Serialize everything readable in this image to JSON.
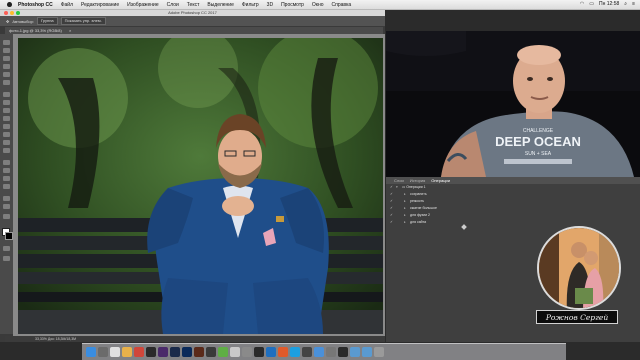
{
  "menubar": {
    "app_name": "Photoshop CC",
    "items": [
      "Файл",
      "Редактирование",
      "Изображение",
      "Слои",
      "Текст",
      "Выделение",
      "Фильтр",
      "3D",
      "Просмотр",
      "Окно",
      "Справка"
    ],
    "clock": "Пн 12:58"
  },
  "window": {
    "title": "Adobe Photoshop CC 2017"
  },
  "options": {
    "auto_select": "Автовыбор:",
    "group": "Группа",
    "transform": "Показать упр. элем."
  },
  "document": {
    "tab_label": "фото-1.jpg @ 33,3% (RGB/8)",
    "status_text": "33,33%        Док: 18,3M/18,3M"
  },
  "actions_panel": {
    "tabs": [
      "Слои",
      "История",
      "Операции"
    ],
    "active_tab": "Операции",
    "items": [
      {
        "label": "Операции 1",
        "level": 0,
        "icon": "folder-icon"
      },
      {
        "label": "сохранить",
        "level": 1
      },
      {
        "label": "резкость",
        "level": 1
      },
      {
        "label": "сжатие большое",
        "level": 1
      },
      {
        "label": "для фузии 2",
        "level": 1
      },
      {
        "label": "для сайта",
        "level": 1
      }
    ]
  },
  "webcam_shirt": {
    "line1": "CHALLENGE",
    "line2": "DEEP OCEAN",
    "line3": "SUN + SEA"
  },
  "signature": "Рожнов Сергей",
  "colors": {
    "accent_blue": "#2d74c4",
    "suit_blue": "#1f4e8a",
    "panel_bg": "#3f3f3f"
  }
}
